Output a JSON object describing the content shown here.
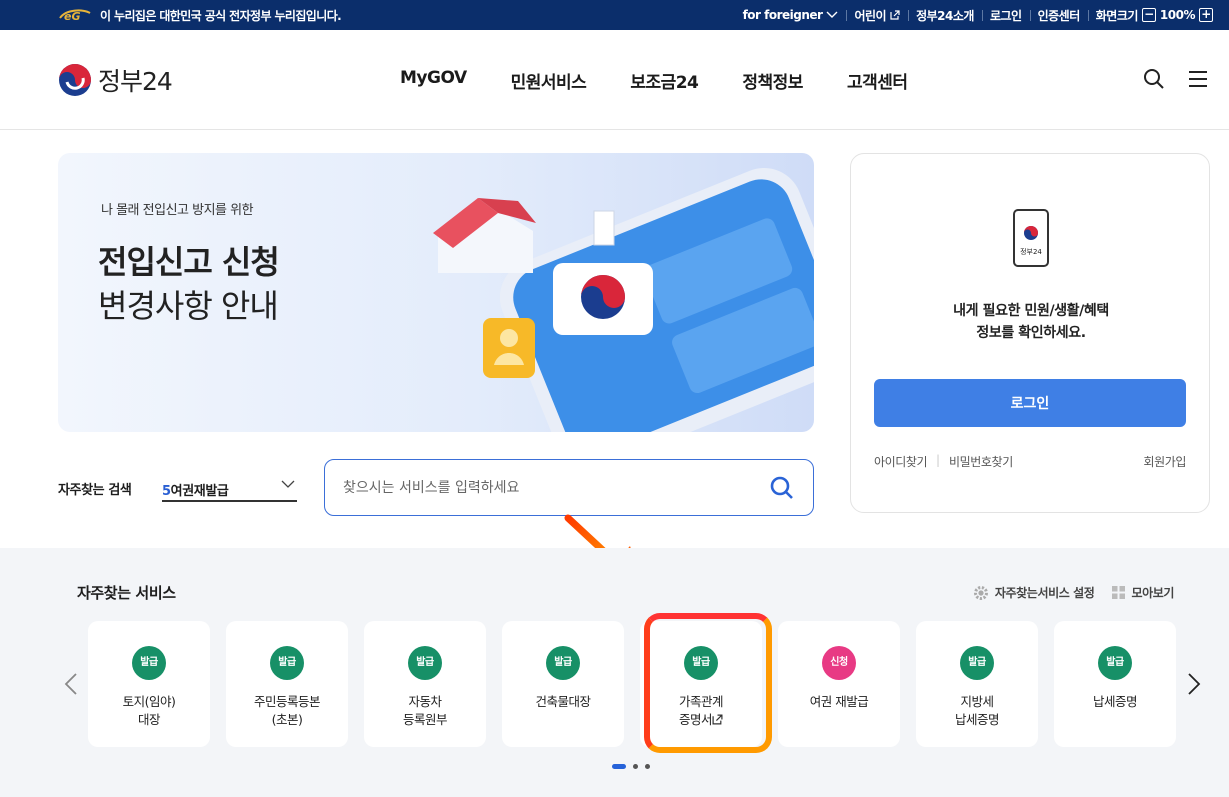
{
  "topbar": {
    "notice": "이 누리집은 대한민국 공식 전자정부 누리집입니다.",
    "foreigner": "for foreigner",
    "kids": "어린이",
    "about": "정부24소개",
    "login": "로그인",
    "cert_center": "인증센터",
    "screen_size": "화면크기",
    "zoom_minus": "−",
    "zoom_value": "100%",
    "zoom_plus": "+"
  },
  "header": {
    "logo_text": "정부24",
    "menu": [
      "MyGOV",
      "민원서비스",
      "보조금24",
      "정책정보",
      "고객센터"
    ]
  },
  "banner": {
    "subtitle": "나 몰래 전입신고 방지를 위한",
    "title_line1": "전입신고 신청",
    "title_line2": "변경사항 안내"
  },
  "login_box": {
    "phone_label": "정부24",
    "message_line1": "내게 필요한 민원/생활/혜택",
    "message_line2": "정보를 확인하세요.",
    "login_button": "로그인",
    "find_id": "아이디찾기",
    "find_password": "비밀번호찾기",
    "join": "회원가입"
  },
  "frequent_search": {
    "label": "자주찾는 검색",
    "selected_rank": "5",
    "selected_text": "여권재발급",
    "placeholder": "찾으시는 서비스를 입력하세요"
  },
  "services": {
    "title": "자주찾는 서비스",
    "settings_label": "자주찾는서비스 설정",
    "view_all_label": "모아보기",
    "cards": [
      {
        "badge": "발급",
        "line1": "토지(임야)",
        "line2": "대장",
        "color": "#179067"
      },
      {
        "badge": "발급",
        "line1": "주민등록등본",
        "line2": "(초본)",
        "color": "#179067"
      },
      {
        "badge": "발급",
        "line1": "자동차",
        "line2": "등록원부",
        "color": "#179067"
      },
      {
        "badge": "발급",
        "line1": "건축물대장",
        "line2": "",
        "color": "#179067"
      },
      {
        "badge": "발급",
        "line1": "가족관계",
        "line2": "증명서",
        "color": "#179067"
      },
      {
        "badge": "신청",
        "line1": "여권 재발급",
        "line2": "",
        "color": "#e83a84"
      },
      {
        "badge": "발급",
        "line1": "지방세",
        "line2": "납세증명",
        "color": "#179067"
      },
      {
        "badge": "발급",
        "line1": "납세증명",
        "line2": "",
        "color": "#179067"
      }
    ]
  },
  "colors": {
    "topbar": "#0b2e6b",
    "primary": "#3f7fe5",
    "issue_badge": "#179067",
    "apply_badge": "#e83a84",
    "highlight": "#ff6a00"
  }
}
